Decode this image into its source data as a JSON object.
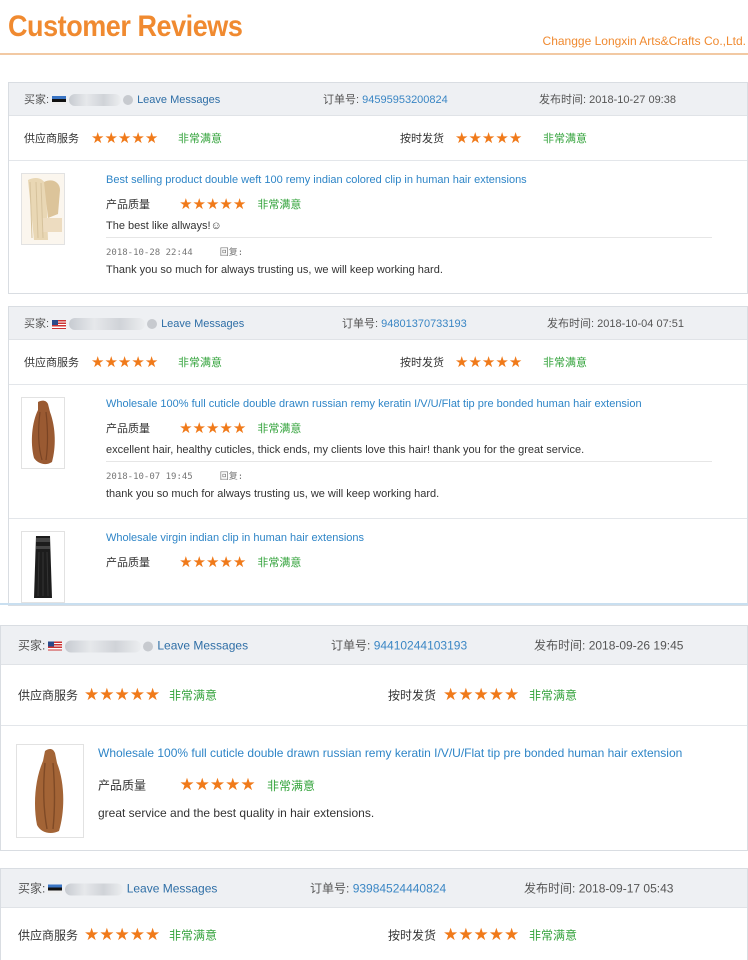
{
  "header": {
    "title": "Customer Reviews",
    "company": "Changge Longxin Arts&Crafts Co.,Ltd."
  },
  "labels": {
    "buyer": "买家:",
    "leave_messages": "Leave Messages",
    "order_no": "订单号:",
    "published": "发布时间:",
    "supplier_service": "供应商服务",
    "on_time_delivery": "按时发货",
    "product_quality": "产品质量",
    "very_satisfied": "非常满意",
    "reply": "回复:"
  },
  "rating_max": 5,
  "reviews": [
    {
      "flag": "ee",
      "order_number": "94595953200824",
      "publish_time": "2018-10-27 09:38",
      "supplier_service_rating": 5,
      "delivery_rating": 5,
      "products": [
        {
          "title": "Best selling product double weft 100 remy indian colored clip in human hair extensions",
          "quality_rating": 5,
          "comment": "The best like allways!☺",
          "reply_date": "2018-10-28 22:44",
          "reply_text": "Thank you so much for always trusting us, we will keep working hard."
        }
      ]
    },
    {
      "flag": "us",
      "order_number": "94801370733193",
      "publish_time": "2018-10-04 07:51",
      "supplier_service_rating": 5,
      "delivery_rating": 5,
      "products": [
        {
          "title": "Wholesale 100% full cuticle double drawn russian remy keratin I/V/U/Flat tip pre bonded human hair extension",
          "quality_rating": 5,
          "comment": "excellent hair, healthy cuticles, thick ends, my clients love this hair! thank you for the great service.",
          "reply_date": "2018-10-07 19:45",
          "reply_text": "thank you so much for always trusting us, we will keep working hard."
        },
        {
          "title": "Wholesale virgin indian clip in human hair extensions",
          "quality_rating": 5
        }
      ]
    },
    {
      "flag": "us",
      "order_number": "94410244103193",
      "publish_time": "2018-09-26 19:45",
      "supplier_service_rating": 5,
      "delivery_rating": 5,
      "products": [
        {
          "title": "Wholesale 100% full cuticle double drawn russian remy keratin I/V/U/Flat tip pre bonded human hair extension",
          "quality_rating": 5,
          "comment": "great service and the best quality in hair extensions."
        }
      ]
    },
    {
      "flag": "ee",
      "order_number": "93984524440824",
      "publish_time": "2018-09-17 05:43",
      "supplier_service_rating": 5,
      "delivery_rating": 5
    }
  ],
  "colors": {
    "accent": "#f08a30",
    "star": "#f07a1a",
    "satisfied": "#33a33b",
    "link": "#2e85c7"
  }
}
